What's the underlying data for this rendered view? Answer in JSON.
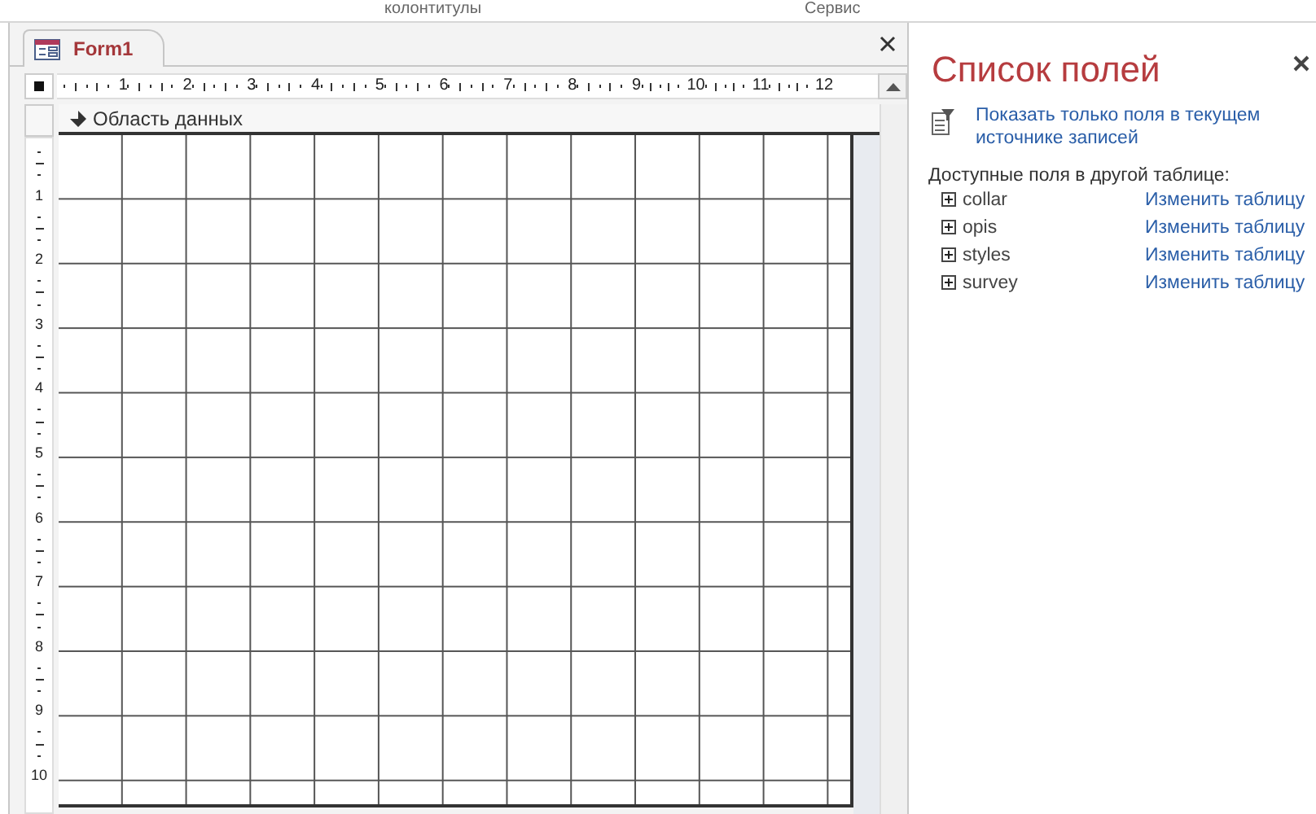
{
  "ribbon": {
    "group_labels": [
      "колонтитулы",
      "Сервис"
    ]
  },
  "document_tab": {
    "title": "Form1",
    "selected": true
  },
  "ruler": {
    "horizontal": [
      "1",
      "2",
      "3",
      "4",
      "5",
      "6",
      "7",
      "8",
      "9",
      "10",
      "11",
      "12"
    ],
    "vertical": [
      "1",
      "2",
      "3",
      "4",
      "5",
      "6",
      "7",
      "8",
      "9",
      "10"
    ]
  },
  "section": {
    "title": "Область данных"
  },
  "field_list": {
    "title": "Список полей",
    "filter_link": "Показать только поля в текущем источнике записей",
    "available_heading": "Доступные поля в другой таблице:",
    "tables": [
      {
        "name": "collar",
        "expanded": false,
        "action": "Изменить таблицу"
      },
      {
        "name": "opis",
        "expanded": false,
        "action": "Изменить таблицу"
      },
      {
        "name": "styles",
        "expanded": false,
        "action": "Изменить таблицу"
      },
      {
        "name": "survey",
        "expanded": false,
        "action": "Изменить таблицу"
      }
    ]
  }
}
